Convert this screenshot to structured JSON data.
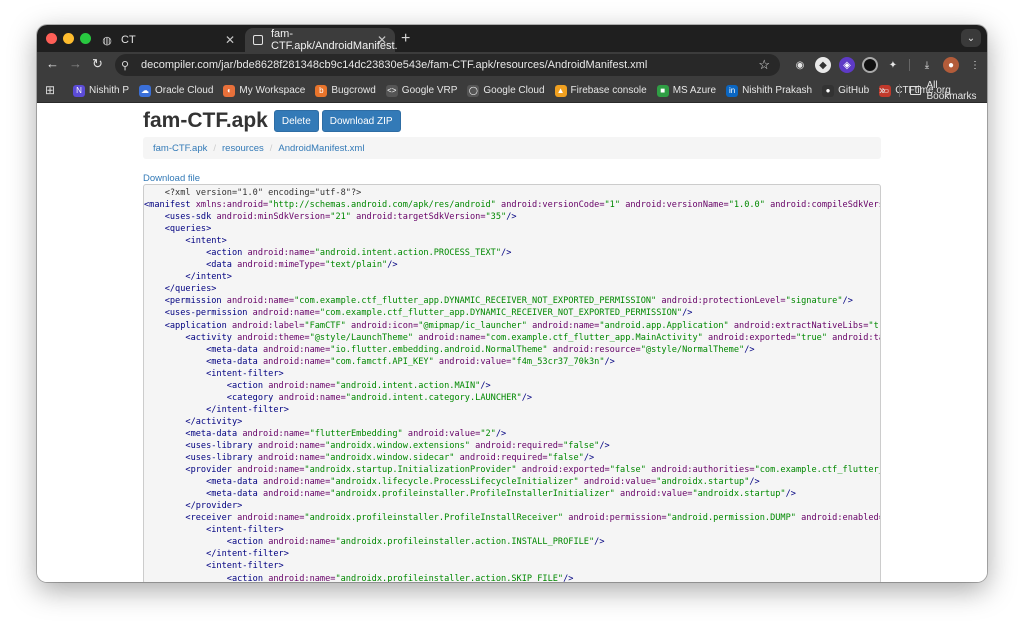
{
  "browser": {
    "tabs": [
      {
        "title": "CT",
        "icon": "globe-icon",
        "active": false
      },
      {
        "title": "fam-CTF.apk/AndroidManifest.",
        "icon": "page-icon",
        "active": true
      }
    ],
    "new_tab_icon": "+",
    "url": "decompiler.com/jar/bde8628f281348cb9c14dc23830e543e/fam-CTF.apk/resources/AndroidManifest.xml",
    "bookmarks": [
      {
        "label": "Nishith P",
        "icon": "N",
        "color": "#5b4bd6"
      },
      {
        "label": "Oracle Cloud",
        "icon": "☁",
        "color": "#3a6fd8"
      },
      {
        "label": "My Workspace",
        "icon": "◐",
        "color": "#e8703a"
      },
      {
        "label": "Bugcrowd",
        "icon": "b",
        "color": "#e8742b"
      },
      {
        "label": "Google VRP",
        "icon": "<>",
        "color": "#555555"
      },
      {
        "label": "Google Cloud",
        "icon": "◯",
        "color": "#555555"
      },
      {
        "label": "Firebase console",
        "icon": "▲",
        "color": "#f0a020"
      },
      {
        "label": "MS Azure",
        "icon": "■",
        "color": "#2f9e44"
      },
      {
        "label": "Nishith Prakash",
        "icon": "in",
        "color": "#0a66c2"
      },
      {
        "label": "GitHub",
        "icon": "●",
        "color": "#333333"
      },
      {
        "label": "CTFtime.org",
        "icon": "▭",
        "color": "#c0392b"
      }
    ],
    "bookmarks_more": "»",
    "all_bookmarks": "All Bookmarks"
  },
  "page": {
    "title": "fam-CTF.apk",
    "delete_label": "Delete",
    "download_zip_label": "Download ZIP",
    "breadcrumb": [
      "fam-CTF.apk",
      "resources",
      "AndroidManifest.xml"
    ],
    "download_file": "Download file"
  },
  "code_lines": [
    [
      [
        "pi",
        "    <?xml version=\"1.0\" encoding=\"utf-8\"?>"
      ]
    ],
    [
      [
        "tag",
        "<manifest "
      ],
      [
        "attr",
        "xmlns:android="
      ],
      [
        "val",
        "\"http://schemas.android.com/apk/res/android\""
      ],
      [
        "attr",
        " android:versionCode="
      ],
      [
        "val",
        "\"1\""
      ],
      [
        "attr",
        " android:versionName="
      ],
      [
        "val",
        "\"1.0.0\""
      ],
      [
        "attr",
        " android:compileSdkVersio"
      ]
    ],
    [
      [
        "tag",
        "    <uses-sdk "
      ],
      [
        "attr",
        "android:minSdkVersion="
      ],
      [
        "val",
        "\"21\""
      ],
      [
        "attr",
        " android:targetSdkVersion="
      ],
      [
        "val",
        "\"35\""
      ],
      [
        "tag",
        "/>"
      ]
    ],
    [
      [
        "tag",
        "    <queries>"
      ]
    ],
    [
      [
        "tag",
        "        <intent>"
      ]
    ],
    [
      [
        "tag",
        "            <action "
      ],
      [
        "attr",
        "android:name="
      ],
      [
        "val",
        "\"android.intent.action.PROCESS_TEXT\""
      ],
      [
        "tag",
        "/>"
      ]
    ],
    [
      [
        "tag",
        "            <data "
      ],
      [
        "attr",
        "android:mimeType="
      ],
      [
        "val",
        "\"text/plain\""
      ],
      [
        "tag",
        "/>"
      ]
    ],
    [
      [
        "tag",
        "        </intent>"
      ]
    ],
    [
      [
        "tag",
        "    </queries>"
      ]
    ],
    [
      [
        "tag",
        "    <permission "
      ],
      [
        "attr",
        "android:name="
      ],
      [
        "val",
        "\"com.example.ctf_flutter_app.DYNAMIC_RECEIVER_NOT_EXPORTED_PERMISSION\""
      ],
      [
        "attr",
        " android:protectionLevel="
      ],
      [
        "val",
        "\"signature\""
      ],
      [
        "tag",
        "/>"
      ]
    ],
    [
      [
        "tag",
        "    <uses-permission "
      ],
      [
        "attr",
        "android:name="
      ],
      [
        "val",
        "\"com.example.ctf_flutter_app.DYNAMIC_RECEIVER_NOT_EXPORTED_PERMISSION\""
      ],
      [
        "tag",
        "/>"
      ]
    ],
    [
      [
        "tag",
        "    <application "
      ],
      [
        "attr",
        "android:label="
      ],
      [
        "val",
        "\"FamCTF\""
      ],
      [
        "attr",
        " android:icon="
      ],
      [
        "val",
        "\"@mipmap/ic_launcher\""
      ],
      [
        "attr",
        " android:name="
      ],
      [
        "val",
        "\"android.app.Application\""
      ],
      [
        "attr",
        " android:extractNativeLibs="
      ],
      [
        "val",
        "\"true"
      ]
    ],
    [
      [
        "tag",
        "        <activity "
      ],
      [
        "attr",
        "android:theme="
      ],
      [
        "val",
        "\"@style/LaunchTheme\""
      ],
      [
        "attr",
        " android:name="
      ],
      [
        "val",
        "\"com.example.ctf_flutter_app.MainActivity\""
      ],
      [
        "attr",
        " android:exported="
      ],
      [
        "val",
        "\"true\""
      ],
      [
        "attr",
        " android:task"
      ]
    ],
    [
      [
        "tag",
        "            <meta-data "
      ],
      [
        "attr",
        "android:name="
      ],
      [
        "val",
        "\"io.flutter.embedding.android.NormalTheme\""
      ],
      [
        "attr",
        " android:resource="
      ],
      [
        "val",
        "\"@style/NormalTheme\""
      ],
      [
        "tag",
        "/>"
      ]
    ],
    [
      [
        "tag",
        "            <meta-data "
      ],
      [
        "attr",
        "android:name="
      ],
      [
        "val",
        "\"com.famctf.API_KEY\""
      ],
      [
        "attr",
        " android:value="
      ],
      [
        "val",
        "\"f4m_53cr37_70k3n\""
      ],
      [
        "tag",
        "/>"
      ]
    ],
    [
      [
        "tag",
        "            <intent-filter>"
      ]
    ],
    [
      [
        "tag",
        "                <action "
      ],
      [
        "attr",
        "android:name="
      ],
      [
        "val",
        "\"android.intent.action.MAIN\""
      ],
      [
        "tag",
        "/>"
      ]
    ],
    [
      [
        "tag",
        "                <category "
      ],
      [
        "attr",
        "android:name="
      ],
      [
        "val",
        "\"android.intent.category.LAUNCHER\""
      ],
      [
        "tag",
        "/>"
      ]
    ],
    [
      [
        "tag",
        "            </intent-filter>"
      ]
    ],
    [
      [
        "tag",
        "        </activity>"
      ]
    ],
    [
      [
        "tag",
        "        <meta-data "
      ],
      [
        "attr",
        "android:name="
      ],
      [
        "val",
        "\"flutterEmbedding\""
      ],
      [
        "attr",
        " android:value="
      ],
      [
        "val",
        "\"2\""
      ],
      [
        "tag",
        "/>"
      ]
    ],
    [
      [
        "tag",
        "        <uses-library "
      ],
      [
        "attr",
        "android:name="
      ],
      [
        "val",
        "\"androidx.window.extensions\""
      ],
      [
        "attr",
        " android:required="
      ],
      [
        "val",
        "\"false\""
      ],
      [
        "tag",
        "/>"
      ]
    ],
    [
      [
        "tag",
        "        <uses-library "
      ],
      [
        "attr",
        "android:name="
      ],
      [
        "val",
        "\"androidx.window.sidecar\""
      ],
      [
        "attr",
        " android:required="
      ],
      [
        "val",
        "\"false\""
      ],
      [
        "tag",
        "/>"
      ]
    ],
    [
      [
        "tag",
        "        <provider "
      ],
      [
        "attr",
        "android:name="
      ],
      [
        "val",
        "\"androidx.startup.InitializationProvider\""
      ],
      [
        "attr",
        " android:exported="
      ],
      [
        "val",
        "\"false\""
      ],
      [
        "attr",
        " android:authorities="
      ],
      [
        "val",
        "\"com.example.ctf_flutter_ap"
      ]
    ],
    [
      [
        "tag",
        "            <meta-data "
      ],
      [
        "attr",
        "android:name="
      ],
      [
        "val",
        "\"androidx.lifecycle.ProcessLifecycleInitializer\""
      ],
      [
        "attr",
        " android:value="
      ],
      [
        "val",
        "\"androidx.startup\""
      ],
      [
        "tag",
        "/>"
      ]
    ],
    [
      [
        "tag",
        "            <meta-data "
      ],
      [
        "attr",
        "android:name="
      ],
      [
        "val",
        "\"androidx.profileinstaller.ProfileInstallerInitializer\""
      ],
      [
        "attr",
        " android:value="
      ],
      [
        "val",
        "\"androidx.startup\""
      ],
      [
        "tag",
        "/>"
      ]
    ],
    [
      [
        "tag",
        "        </provider>"
      ]
    ],
    [
      [
        "tag",
        "        <receiver "
      ],
      [
        "attr",
        "android:name="
      ],
      [
        "val",
        "\"androidx.profileinstaller.ProfileInstallReceiver\""
      ],
      [
        "attr",
        " android:permission="
      ],
      [
        "val",
        "\"android.permission.DUMP\""
      ],
      [
        "attr",
        " android:enabled="
      ],
      [
        "val",
        "\"t"
      ]
    ],
    [
      [
        "tag",
        "            <intent-filter>"
      ]
    ],
    [
      [
        "tag",
        "                <action "
      ],
      [
        "attr",
        "android:name="
      ],
      [
        "val",
        "\"androidx.profileinstaller.action.INSTALL_PROFILE\""
      ],
      [
        "tag",
        "/>"
      ]
    ],
    [
      [
        "tag",
        "            </intent-filter>"
      ]
    ],
    [
      [
        "tag",
        "            <intent-filter>"
      ]
    ],
    [
      [
        "tag",
        "                <action "
      ],
      [
        "attr",
        "android:name="
      ],
      [
        "val",
        "\"androidx.profileinstaller.action.SKIP_FILE\""
      ],
      [
        "tag",
        "/>"
      ]
    ]
  ]
}
